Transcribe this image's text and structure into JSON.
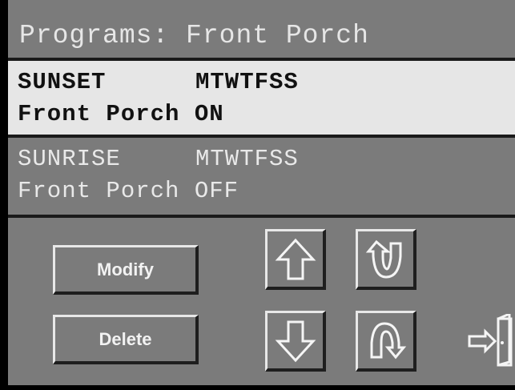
{
  "header": {
    "title": "Programs: Front Porch"
  },
  "programs": [
    {
      "trigger": "SUNSET",
      "days": "MTWTFSS",
      "action": "Front Porch ON",
      "selected": true
    },
    {
      "trigger": "SUNRISE",
      "days": "MTWTFSS",
      "action": "Front Porch OFF",
      "selected": false
    }
  ],
  "buttons": {
    "modify_label": "Modify",
    "delete_label": "Delete"
  },
  "icons": {
    "up": "arrow-up-icon",
    "down": "arrow-down-icon",
    "page_up": "page-up-icon",
    "page_down": "page-down-icon",
    "exit": "exit-door-icon"
  },
  "colors": {
    "background": "#7b7b7b",
    "selected_row": "#e6e6e6",
    "text_light": "#e6e6e6",
    "text_dark": "#111111"
  }
}
